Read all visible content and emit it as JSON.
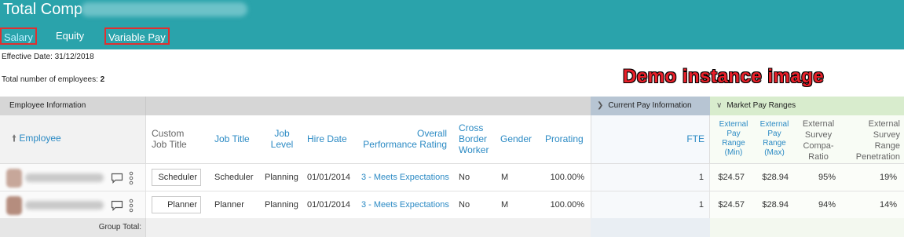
{
  "header": {
    "app_title": "Total Comp",
    "tabs": [
      {
        "label": "Salary"
      },
      {
        "label": "Equity"
      },
      {
        "label": "Variable Pay"
      }
    ]
  },
  "info": {
    "effective_date": "Effective Date: 31/12/2018",
    "total_label": "Total number of employees: ",
    "total_count": "2"
  },
  "watermark": "Demo instance image",
  "groups": {
    "employee_info": "Employee Information",
    "current_pay": "Current Pay Information",
    "market_pay": "Market Pay Ranges"
  },
  "columns": {
    "employee": "Employee",
    "custom_job_title_1": "Custom",
    "custom_job_title_2": "Job Title",
    "job_title": "Job Title",
    "job_level_1": "Job",
    "job_level_2": "Level",
    "hire_date": "Hire Date",
    "overall_perf_1": "Overall",
    "overall_perf_2": "Performance Rating",
    "cross_border_1": "Cross",
    "cross_border_2": "Border",
    "cross_border_3": "Worker",
    "gender": "Gender",
    "prorating": "Prorating",
    "fte": "FTE",
    "ext_min_1": "External",
    "ext_min_2": "Pay",
    "ext_min_3": "Range",
    "ext_min_4": "(Min)",
    "ext_max_1": "External",
    "ext_max_2": "Pay",
    "ext_max_3": "Range",
    "ext_max_4": "(Max)",
    "compa_1": "External",
    "compa_2": "Survey",
    "compa_3": "Compa-",
    "compa_4": "Ratio",
    "pen_1": "External",
    "pen_2": "Survey",
    "pen_3": "Range",
    "pen_4": "Penetration"
  },
  "rows": [
    {
      "custom_job_title": "Scheduler",
      "job_title": "Scheduler",
      "job_level": "Planning",
      "hire_date": "01/01/2014",
      "performance": "3 - Meets Expectations",
      "cross_border": "No",
      "gender": "M",
      "prorating": "100.00%",
      "fte": "1",
      "ext_min": "$24.57",
      "ext_max": "$28.94",
      "compa_ratio": "95%",
      "penetration": "19%"
    },
    {
      "custom_job_title": "Planner",
      "job_title": "Planner",
      "job_level": "Planning",
      "hire_date": "01/01/2014",
      "performance": "3 - Meets Expectations",
      "cross_border": "No",
      "gender": "M",
      "prorating": "100.00%",
      "fte": "1",
      "ext_min": "$24.57",
      "ext_max": "$28.94",
      "compa_ratio": "94%",
      "penetration": "14%"
    }
  ],
  "total_row": {
    "label": "Group Total:"
  },
  "icons": {
    "sort": "arrow-up-icon",
    "comment": "comment-icon",
    "more": "more-vertical-icon",
    "expand_current_pay": "chevron-right-icon",
    "collapse_market": "chevron-down-icon"
  },
  "colors": {
    "topbar": "#2aa3ab",
    "link": "#2b8ac4",
    "highlight_box": "#e03030",
    "current_pay_header": "#b7c5d3",
    "market_pay_header": "#d8eccd"
  }
}
